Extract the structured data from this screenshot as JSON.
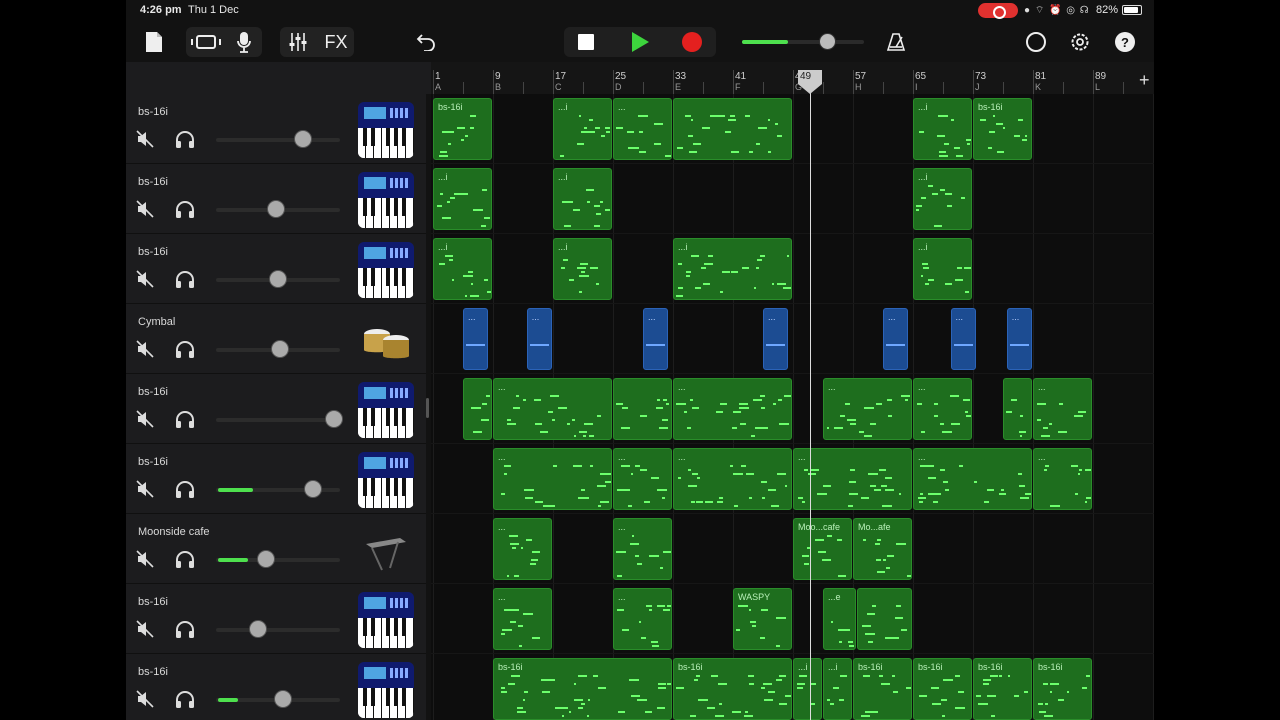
{
  "status": {
    "time": "4:26 pm",
    "date": "Thu 1 Dec",
    "battery": "82%"
  },
  "toolbar": {
    "fx_label": "FX",
    "master_volume": 0.7
  },
  "ruler": {
    "bars": [
      {
        "n": "1",
        "s": "A"
      },
      {
        "n": "9",
        "s": "B"
      },
      {
        "n": "17",
        "s": "C"
      },
      {
        "n": "25",
        "s": "D"
      },
      {
        "n": "33",
        "s": "E"
      },
      {
        "n": "41",
        "s": "F"
      },
      {
        "n": "49",
        "s": "G"
      },
      {
        "n": "57",
        "s": "H"
      },
      {
        "n": "65",
        "s": "I"
      },
      {
        "n": "73",
        "s": "J"
      },
      {
        "n": "81",
        "s": "K"
      },
      {
        "n": "89",
        "s": "L"
      }
    ],
    "playhead_bar": "49",
    "add_label": "+"
  },
  "tracks": [
    {
      "name": "bs-16i",
      "instrument": "synth-keyboard-icon",
      "volume": 0.7,
      "level": 0
    },
    {
      "name": "bs-16i",
      "instrument": "synth-keyboard-icon",
      "volume": 0.48,
      "level": 0
    },
    {
      "name": "bs-16i",
      "instrument": "synth-keyboard-icon",
      "volume": 0.5,
      "level": 0
    },
    {
      "name": "Cymbal",
      "instrument": "drums-icon",
      "volume": 0.52,
      "level": 0
    },
    {
      "name": "bs-16i",
      "instrument": "synth-keyboard-icon",
      "volume": 0.95,
      "level": 0
    },
    {
      "name": "bs-16i",
      "instrument": "synth-keyboard-icon",
      "volume": 0.78,
      "level": 0.28
    },
    {
      "name": "Moonside cafe",
      "instrument": "keyboard-stand-icon",
      "volume": 0.4,
      "level": 0.24
    },
    {
      "name": "bs-16i",
      "instrument": "synth-keyboard-icon",
      "volume": 0.34,
      "level": 0
    },
    {
      "name": "bs-16i",
      "instrument": "synth-keyboard-icon",
      "volume": 0.54,
      "level": 0.16
    }
  ],
  "regions": [
    [
      {
        "s": 1,
        "e": 9,
        "label": "bs-16i"
      },
      {
        "s": 17,
        "e": 25,
        "label": "...i"
      },
      {
        "s": 25,
        "e": 33,
        "label": "..."
      },
      {
        "s": 33,
        "e": 49,
        "label": ""
      },
      {
        "s": 65,
        "e": 73,
        "label": "...i"
      },
      {
        "s": 73,
        "e": 81,
        "label": "bs-16i"
      }
    ],
    [
      {
        "s": 1,
        "e": 9,
        "label": "...i"
      },
      {
        "s": 17,
        "e": 25,
        "label": "...i"
      },
      {
        "s": 65,
        "e": 73,
        "label": "...i"
      }
    ],
    [
      {
        "s": 1,
        "e": 9,
        "label": "...i"
      },
      {
        "s": 17,
        "e": 25,
        "label": "...i"
      },
      {
        "s": 33,
        "e": 49,
        "label": "...i"
      },
      {
        "s": 65,
        "e": 73,
        "label": "...i"
      }
    ],
    [
      {
        "s": 5,
        "e": 8.5,
        "label": "...",
        "blue": true
      },
      {
        "s": 13.5,
        "e": 17,
        "label": "...",
        "blue": true
      },
      {
        "s": 29,
        "e": 32.5,
        "label": "...",
        "blue": true
      },
      {
        "s": 45,
        "e": 48.5,
        "label": "...",
        "blue": true
      },
      {
        "s": 61,
        "e": 64.5,
        "label": "...",
        "blue": true
      },
      {
        "s": 70,
        "e": 73.5,
        "label": "...",
        "blue": true
      },
      {
        "s": 77.5,
        "e": 81,
        "label": "...",
        "blue": true
      }
    ],
    [
      {
        "s": 5,
        "e": 9,
        "label": ""
      },
      {
        "s": 9,
        "e": 25,
        "label": "..."
      },
      {
        "s": 25,
        "e": 33,
        "label": ""
      },
      {
        "s": 33,
        "e": 49,
        "label": "..."
      },
      {
        "s": 53,
        "e": 65,
        "label": "..."
      },
      {
        "s": 65,
        "e": 73,
        "label": "..."
      },
      {
        "s": 77,
        "e": 81,
        "label": ""
      },
      {
        "s": 81,
        "e": 89,
        "label": "..."
      }
    ],
    [
      {
        "s": 9,
        "e": 25,
        "label": "..."
      },
      {
        "s": 25,
        "e": 33,
        "label": "..."
      },
      {
        "s": 33,
        "e": 49,
        "label": "..."
      },
      {
        "s": 49,
        "e": 65,
        "label": "..."
      },
      {
        "s": 65,
        "e": 81,
        "label": "..."
      },
      {
        "s": 81,
        "e": 89,
        "label": "..."
      }
    ],
    [
      {
        "s": 9,
        "e": 17,
        "label": "..."
      },
      {
        "s": 25,
        "e": 33,
        "label": "..."
      },
      {
        "s": 49,
        "e": 57,
        "label": "Moo...cafe"
      },
      {
        "s": 57,
        "e": 65,
        "label": "Mo...afe"
      }
    ],
    [
      {
        "s": 9,
        "e": 17,
        "label": "..."
      },
      {
        "s": 25,
        "e": 33,
        "label": "..."
      },
      {
        "s": 41,
        "e": 49,
        "label": "WASPY"
      },
      {
        "s": 53,
        "e": 57.5,
        "label": "...e"
      },
      {
        "s": 57.5,
        "e": 65,
        "label": ""
      }
    ],
    [
      {
        "s": 9,
        "e": 33,
        "label": "bs-16i"
      },
      {
        "s": 33,
        "e": 49,
        "label": "bs-16i"
      },
      {
        "s": 49,
        "e": 53,
        "label": "...i"
      },
      {
        "s": 53,
        "e": 57,
        "label": "...i"
      },
      {
        "s": 57,
        "e": 65,
        "label": "bs-16i"
      },
      {
        "s": 65,
        "e": 73,
        "label": "bs-16i"
      },
      {
        "s": 73,
        "e": 81,
        "label": "bs-16i"
      },
      {
        "s": 81,
        "e": 89,
        "label": "bs-16i"
      }
    ]
  ],
  "colors": {
    "region_green": "#1e6e1e",
    "region_blue": "#1c4c92",
    "note_green": "#6cff6c",
    "play_green": "#3dd43d",
    "record_red": "#e4201f"
  }
}
